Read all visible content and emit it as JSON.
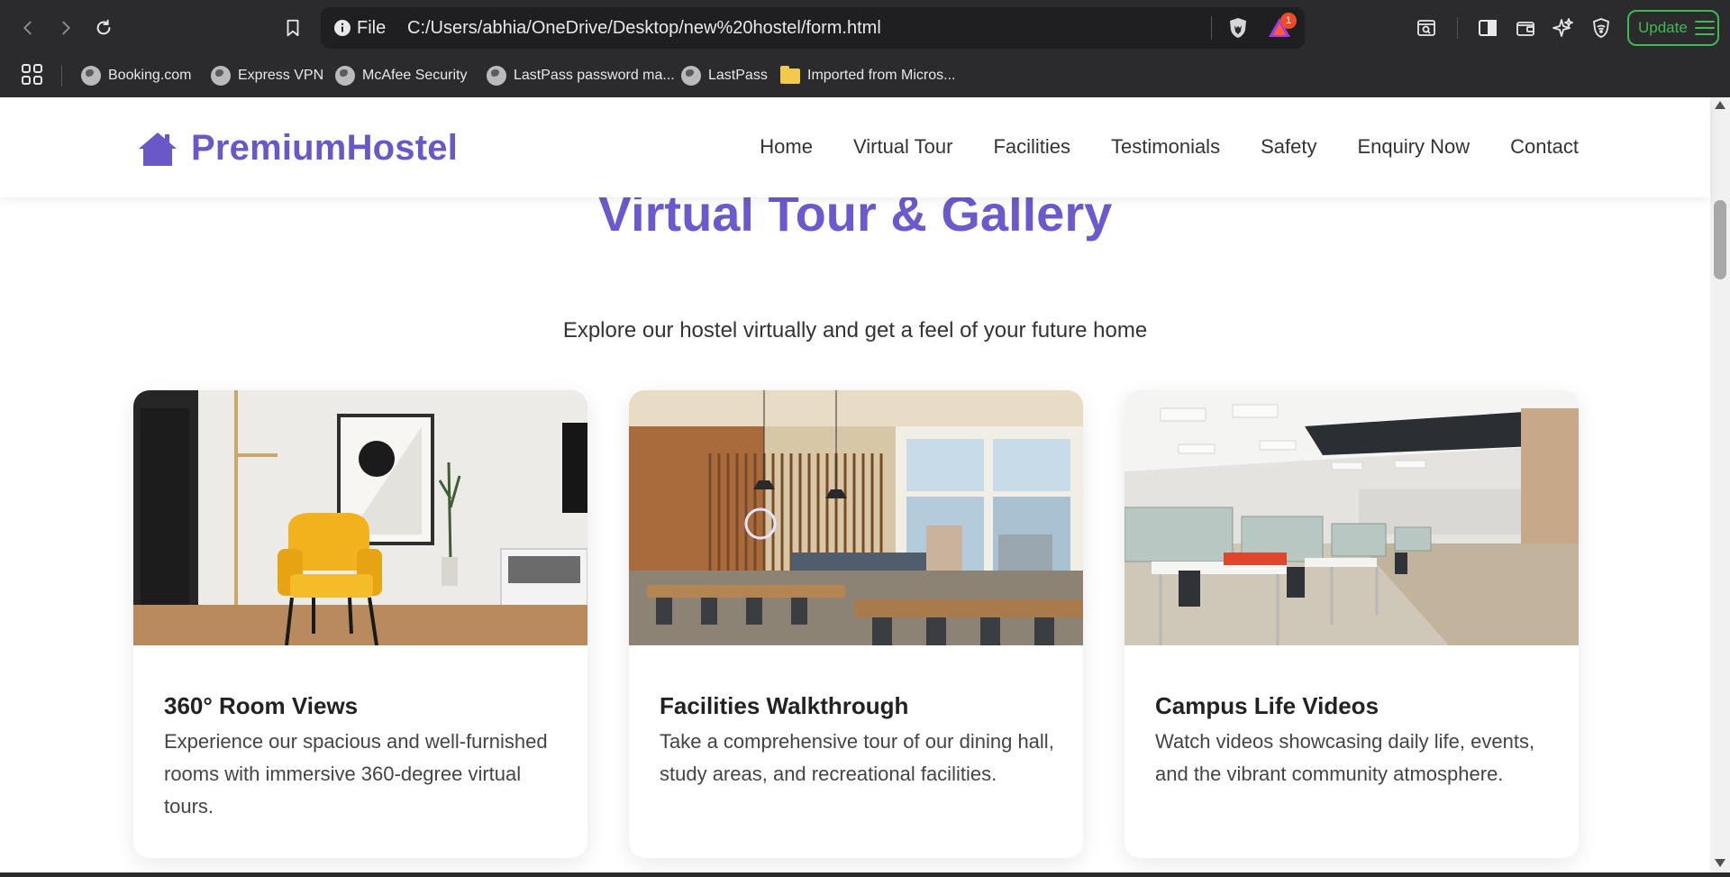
{
  "browser": {
    "scheme": "File",
    "url": "C:/Users/abhia/OneDrive/Desktop/new%20hostel/form.html",
    "rewards_badge": "1",
    "update_label": "Update",
    "bookmarks": [
      {
        "label": "Booking.com",
        "icon": "globe-icon"
      },
      {
        "label": "Express VPN",
        "icon": "globe-icon"
      },
      {
        "label": "McAfee Security",
        "icon": "globe-icon"
      },
      {
        "label": "LastPass password ma...",
        "icon": "globe-icon"
      },
      {
        "label": "LastPass",
        "icon": "globe-icon"
      },
      {
        "label": "Imported from Micros...",
        "icon": "folder-icon"
      }
    ],
    "update_color": "#3fb950"
  },
  "site": {
    "brand": "PremiumHostel",
    "brand_color": "#6a58c8",
    "nav": [
      "Home",
      "Virtual Tour",
      "Facilities",
      "Testimonials",
      "Safety",
      "Enquiry Now",
      "Contact"
    ]
  },
  "section": {
    "title": "Virtual Tour & Gallery",
    "subtitle": "Explore our hostel virtually and get a feel of your future home",
    "title_color": "#6a5acd"
  },
  "cards": [
    {
      "title": "360° Room Views",
      "description": "Experience our spacious and well-furnished rooms with immersive 360-degree virtual tours."
    },
    {
      "title": "Facilities Walkthrough",
      "description": "Take a comprehensive tour of our dining hall, study areas, and recreational facilities."
    },
    {
      "title": "Campus Life Videos",
      "description": "Watch videos showcasing daily life, events, and the vibrant community atmosphere."
    }
  ]
}
